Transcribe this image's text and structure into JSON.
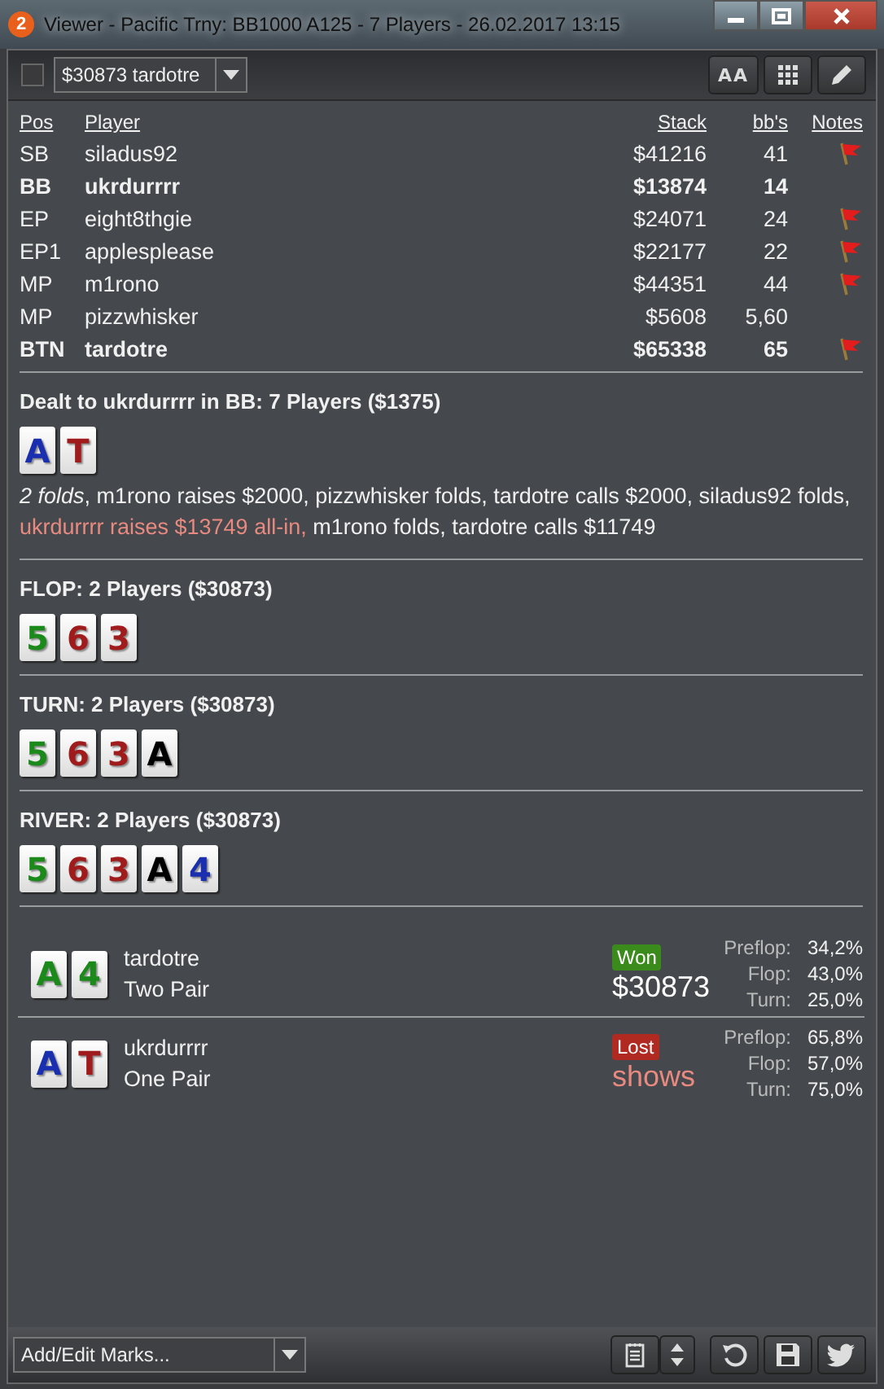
{
  "window": {
    "logo": "2",
    "title": "Viewer - Pacific Trny: BB1000 A125 - 7 Players - 26.02.2017 13:15"
  },
  "toolbar": {
    "checked": false,
    "hand_select": "$30873 tardotre",
    "font_button": "AA"
  },
  "table": {
    "columns": [
      "Pos",
      "Player",
      "Stack",
      "bb's",
      "Notes"
    ],
    "rows": [
      {
        "pos": "SB",
        "player": "siladus92",
        "stack": "$41216",
        "bbs": "41",
        "bold": false,
        "note": true
      },
      {
        "pos": "BB",
        "player": "ukrdurrrr",
        "stack": "$13874",
        "bbs": "14",
        "bold": true,
        "note": false
      },
      {
        "pos": "EP",
        "player": "eight8thgie",
        "stack": "$24071",
        "bbs": "24",
        "bold": false,
        "note": true
      },
      {
        "pos": "EP1",
        "player": "applesplease",
        "stack": "$22177",
        "bbs": "22",
        "bold": false,
        "note": true
      },
      {
        "pos": "MP",
        "player": "m1rono",
        "stack": "$44351",
        "bbs": "44",
        "bold": false,
        "note": true
      },
      {
        "pos": "MP",
        "player": "pizzwhisker",
        "stack": "$5608",
        "bbs": "5,60",
        "bold": false,
        "note": false
      },
      {
        "pos": "BTN",
        "player": "tardotre",
        "stack": "$65338",
        "bbs": "65",
        "bold": true,
        "note": true
      }
    ]
  },
  "streets": [
    {
      "title": "Dealt to ukrdurrrr in BB: 7 Players ($1375)",
      "cards": [
        {
          "rank": "A",
          "color": "#1a2fb0"
        },
        {
          "rank": "T",
          "color": "#a01c1c"
        }
      ],
      "actions": [
        {
          "kind": "italic",
          "text": "2 folds"
        },
        {
          "kind": "plain",
          "text": ", m1rono raises $2000, pizzwhisker folds, tardotre calls $2000, siladus92 folds, "
        },
        {
          "kind": "allin",
          "text": "ukrdurrrr raises $13749 all-in,"
        },
        {
          "kind": "plain",
          "text": " m1rono folds, tardotre calls $11749"
        }
      ]
    },
    {
      "title": "FLOP: 2 Players ($30873)",
      "cards": [
        {
          "rank": "5",
          "color": "#1b8a1b"
        },
        {
          "rank": "6",
          "color": "#a01c1c"
        },
        {
          "rank": "3",
          "color": "#a01c1c"
        }
      ]
    },
    {
      "title": "TURN: 2 Players ($30873)",
      "cards": [
        {
          "rank": "5",
          "color": "#1b8a1b"
        },
        {
          "rank": "6",
          "color": "#a01c1c"
        },
        {
          "rank": "3",
          "color": "#a01c1c"
        },
        {
          "rank": "A",
          "color": "#000000"
        }
      ]
    },
    {
      "title": "RIVER: 2 Players ($30873)",
      "cards": [
        {
          "rank": "5",
          "color": "#1b8a1b"
        },
        {
          "rank": "6",
          "color": "#a01c1c"
        },
        {
          "rank": "3",
          "color": "#a01c1c"
        },
        {
          "rank": "A",
          "color": "#000000"
        },
        {
          "rank": "4",
          "color": "#1a2fb0"
        }
      ]
    }
  ],
  "results": [
    {
      "cards": [
        {
          "rank": "A",
          "color": "#1b8a1b"
        },
        {
          "rank": "4",
          "color": "#1b8a1b"
        }
      ],
      "player": "tardotre",
      "hand": "Two Pair",
      "kind": "won",
      "badge": "Won",
      "amount": "$30873",
      "equity": [
        {
          "label": "Preflop:",
          "value": "34,2%"
        },
        {
          "label": "Flop:",
          "value": "43,0%"
        },
        {
          "label": "Turn:",
          "value": "25,0%"
        }
      ]
    },
    {
      "cards": [
        {
          "rank": "A",
          "color": "#1a2fb0"
        },
        {
          "rank": "T",
          "color": "#a01c1c"
        }
      ],
      "player": "ukrdurrrr",
      "hand": "One Pair",
      "kind": "lost",
      "badge": "Lost",
      "amount": "shows",
      "equity": [
        {
          "label": "Preflop:",
          "value": "65,8%"
        },
        {
          "label": "Flop:",
          "value": "57,0%"
        },
        {
          "label": "Turn:",
          "value": "75,0%"
        }
      ]
    }
  ],
  "footer": {
    "marks_select": "Add/Edit Marks..."
  }
}
